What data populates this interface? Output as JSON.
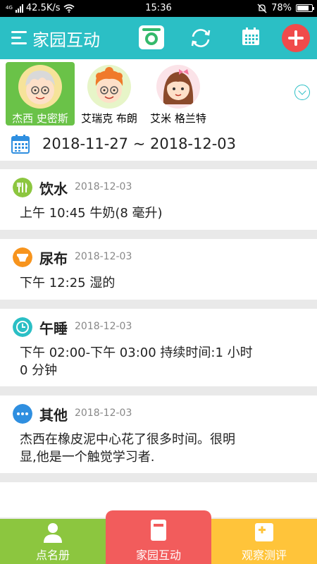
{
  "status_bar": {
    "network": "4G",
    "speed": "42.5K/s",
    "time": "15:36",
    "battery": "78%",
    "battery_level": 0.78
  },
  "header": {
    "title": "家园互动"
  },
  "children": [
    {
      "name": "杰西 史密斯",
      "selected": true
    },
    {
      "name": "艾瑞克 布朗",
      "selected": false
    },
    {
      "name": "艾米 格兰特",
      "selected": false
    }
  ],
  "date_range": {
    "text": "2018-11-27 ~ 2018-12-03"
  },
  "records": [
    {
      "title": "饮水",
      "date": "2018-12-03",
      "body": "上午 10:45 牛奶(8 毫升)",
      "icon": "utensils-icon",
      "color": "#8cc63f"
    },
    {
      "title": "尿布",
      "date": "2018-12-03",
      "body": "下午 12:25 湿的",
      "icon": "diaper-icon",
      "color": "#f7941d"
    },
    {
      "title": "午睡",
      "date": "2018-12-03",
      "body_lines": [
        "下午 02:00-下午 03:00 持续时间:1 小时",
        "0 分钟"
      ],
      "icon": "clock-icon",
      "color": "#2bbfc5"
    },
    {
      "title": "其他",
      "date": "2018-12-03",
      "body_lines": [
        "杰西在橡皮泥中心花了很多时间。很明",
        "显,他是一个触觉学习者."
      ],
      "icon": "more-icon",
      "color": "#2f8fe0"
    }
  ],
  "bottom_nav": [
    {
      "label": "点名册",
      "color": "#8cc63f",
      "icon": "person-icon"
    },
    {
      "label": "家园互动",
      "color": "#f25c5c",
      "icon": "notebook-icon",
      "active": true
    },
    {
      "label": "观察测评",
      "color": "#ffc43a",
      "icon": "add-note-icon"
    }
  ],
  "colors": {
    "primary": "#2bbfc5",
    "add_button": "#f04b4b",
    "selected_child": "#6ac248"
  }
}
